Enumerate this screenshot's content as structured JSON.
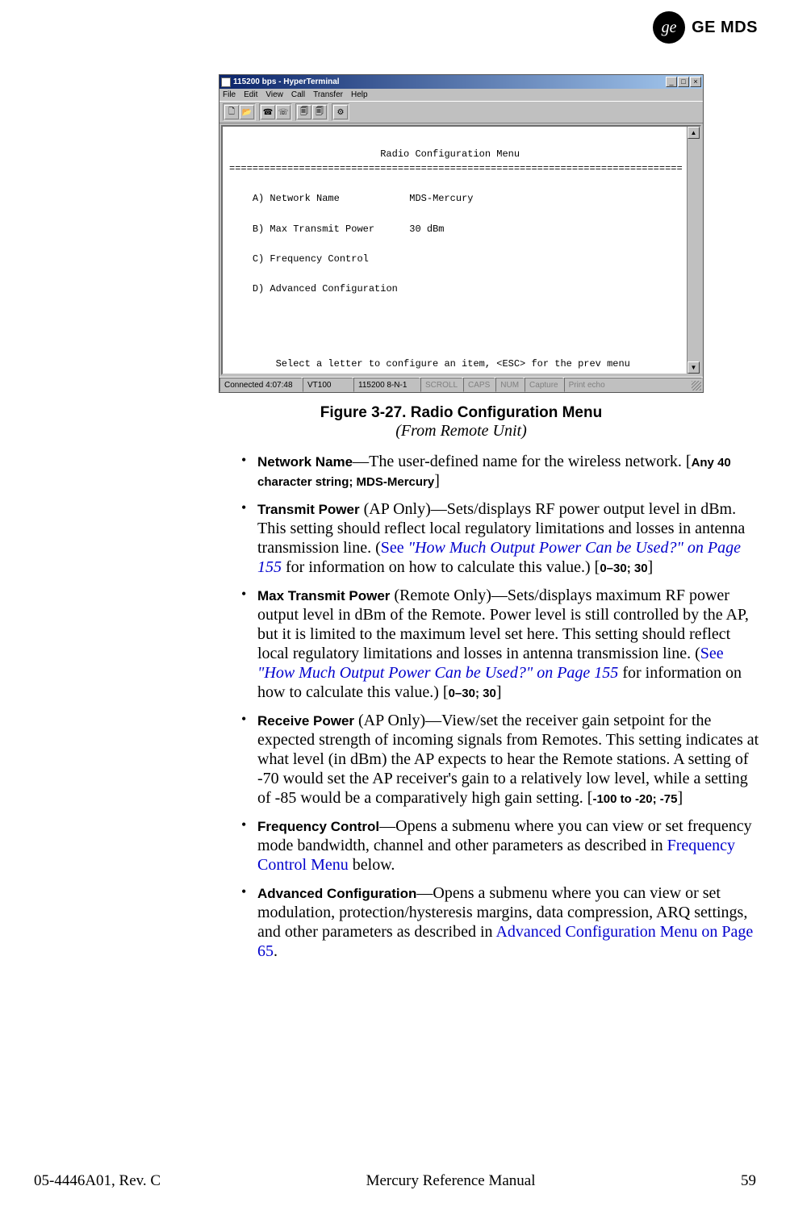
{
  "logo": {
    "monogram": "ge",
    "brand": "GE MDS"
  },
  "window": {
    "title": "115200 bps - HyperTerminal",
    "menus": [
      "File",
      "Edit",
      "View",
      "Call",
      "Transfer",
      "Help"
    ],
    "winbuttons": {
      "min": "_",
      "max": "□",
      "close": "×"
    }
  },
  "terminal": {
    "heading": "Radio Configuration Menu",
    "rule": "==============================================================================",
    "items": [
      {
        "key": "A)",
        "label": "Network Name",
        "value": "MDS-Mercury"
      },
      {
        "key": "B)",
        "label": "Max Transmit Power",
        "value": "30 dBm"
      },
      {
        "key": "C)",
        "label": "Frequency Control",
        "value": ""
      },
      {
        "key": "D)",
        "label": "Advanced Configuration",
        "value": ""
      }
    ],
    "hint": "Select a letter to configure an item, <ESC> for the prev menu"
  },
  "statusbar": {
    "conn": "Connected 4:07:48",
    "emu": "VT100",
    "port": "115200 8-N-1",
    "flags": [
      "SCROLL",
      "CAPS",
      "NUM",
      "Capture",
      "Print echo"
    ]
  },
  "caption": {
    "title": "Figure 3-27. Radio Configuration Menu",
    "sub": "(From Remote Unit)"
  },
  "bullets": {
    "b1": {
      "label": "Network Name",
      "text": "—The user-defined name for the wireless network. [",
      "param": "Any 40 character string; MDS-Mercury",
      "tail": "]"
    },
    "b2": {
      "label": "Transmit Power",
      "t1": " (AP Only)—Sets/displays RF power output level in dBm. This setting should reflect local regulatory limitations and losses in antenna transmission line. (",
      "see": "See ",
      "ref": "\"How Much Output Power Can be Used?\" on Page 155",
      "t2": " for information on how to calculate this value.) [",
      "param": "0–30; 30",
      "t3": "]"
    },
    "b3": {
      "label": "Max Transmit Power",
      "t1": " (Remote Only)—Sets/displays maximum RF power output level in dBm of the Remote. Power level is still controlled by the AP, but it is limited to the maximum level set here. This setting should reflect local regulatory limitations and losses in antenna transmission line. (",
      "see": "See ",
      "ref": "\"How Much Output Power Can be Used?\" on Page 155",
      "t2": " for information on how to calculate this value.) [",
      "param": "0–30; 30",
      "t3": "]"
    },
    "b4": {
      "label": "Receive Power",
      "t1": " (AP Only)—View/set the receiver gain setpoint for the expected strength of incoming signals from Remotes. This setting indicates at what level (in dBm) the AP expects to hear the Remote stations. A setting of -70 would set the AP receiver's gain to a relatively low level, while a setting of -85 would be a comparatively high gain setting. [",
      "param": "-100 to -20; -75",
      "t2": "]"
    },
    "b5": {
      "label": "Frequency Control",
      "t1": "—Opens a submenu where you can view or set frequency mode bandwidth, channel and other parameters as described in ",
      "ref": "Frequency Control Menu",
      "t2": " below."
    },
    "b6": {
      "label": "Advanced Configuration",
      "t1": "—Opens a submenu where you can view or set modulation, protection/hysteresis margins, data compression, ARQ settings, and other parameters as described in ",
      "ref": "Advanced Configuration Menu on Page 65",
      "t2": "."
    }
  },
  "footer": {
    "left": "05-4446A01, Rev. C",
    "center": "Mercury Reference Manual",
    "right": "59"
  }
}
